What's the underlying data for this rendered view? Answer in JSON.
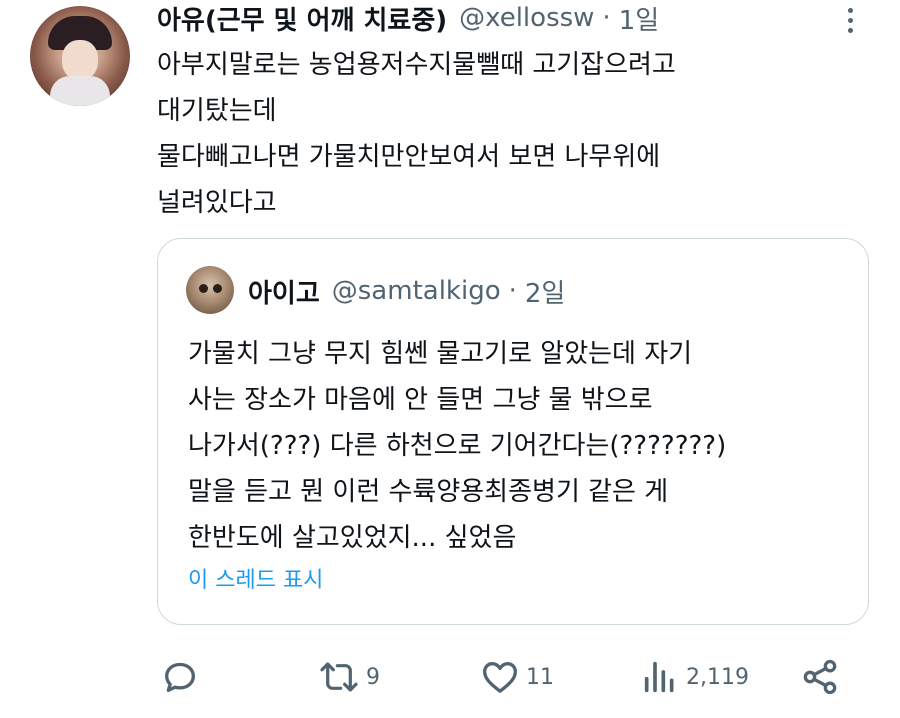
{
  "tweet": {
    "author_name": "아유(근무 및 어깨 치료중)",
    "handle": "@xellossw",
    "separator": "·",
    "time": "1일",
    "lines": [
      "아부지말로는 농업용저수지물뺄때 고기잡으려고",
      "대기탔는데",
      "물다빼고나면 가물치만안보여서  보면 나무위에",
      "널려있다고"
    ]
  },
  "quote": {
    "author_name": "아이고",
    "handle": "@samtalkigo",
    "separator": "·",
    "time": "2일",
    "lines": [
      "가물치 그냥 무지 힘쎈 물고기로 알았는데 자기",
      "사는 장소가 마음에 안 들면 그냥 물 밖으로",
      "나가서(???) 다른 하천으로 기어간다는(???????)",
      "말을 듣고 뭔 이런 수륙양용최종병기 같은 게",
      "한반도에 살고있었지... 싶었음"
    ],
    "show_thread": "이 스레드 표시"
  },
  "actions": {
    "reply_icon": "reply-icon",
    "retweet_icon": "retweet-icon",
    "retweet_count": "9",
    "like_icon": "heart-icon",
    "like_count": "11",
    "views_icon": "views-icon",
    "views_count": "2,119",
    "share_icon": "share-icon"
  },
  "colors": {
    "text": "#0f1419",
    "secondary": "#536471",
    "link": "#1d9bf0",
    "border": "#cfd9de"
  }
}
